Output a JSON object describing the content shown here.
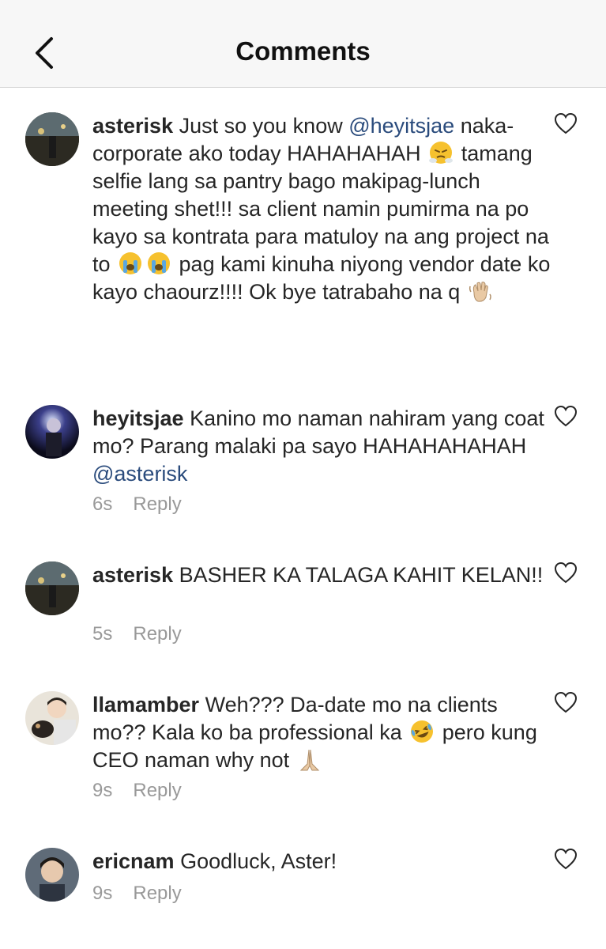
{
  "header": {
    "title": "Comments",
    "back_icon": "chevron-left-icon"
  },
  "comments": [
    {
      "username": "asterisk",
      "segments": {
        "t1": "Just so you know ",
        "m1": "@heyitsjae",
        "t2": " naka-corporate ako today HAHAHAHAH ",
        "t3": " tamang selfie lang sa pantry bago makipag-lunch meeting shet!!! sa client namin pumirma na po kayo sa kontrata para matuloy na ang project na to ",
        "t4": " pag kami kinuha niyong vendor date ko kayo chaourz!!!! Ok bye tatrabaho na q "
      },
      "emojis": [
        "steam-face-emoji",
        "crying-face-emoji",
        "crying-face-emoji",
        "waving-hand-emoji"
      ]
    },
    {
      "username": "heyitsjae",
      "segments": {
        "t1": "Kanino mo naman nahiram yang coat mo? Parang malaki pa sayo HAHAHAHAHAH ",
        "m1": "@asterisk"
      },
      "time": "6s",
      "reply": "Reply"
    },
    {
      "username": "asterisk",
      "segments": {
        "t1": "BASHER KA TALAGA KAHIT KELAN!!"
      },
      "time": "5s",
      "reply": "Reply"
    },
    {
      "username": "llamamber",
      "segments": {
        "t1": "Weh??? Da-date mo na clients mo?? Kala ko ba professional ka ",
        "t2": " pero kung CEO naman why not "
      },
      "emojis": [
        "rolling-laughing-emoji",
        "folded-hands-emoji"
      ],
      "time": "9s",
      "reply": "Reply"
    },
    {
      "username": "ericnam",
      "segments": {
        "t1": "Goodluck, Aster!"
      },
      "time": "9s",
      "reply": "Reply"
    }
  ],
  "colors": {
    "header_bg": "#f7f7f7",
    "text": "#262626",
    "mention": "#2a4b7c",
    "meta": "#999999"
  }
}
